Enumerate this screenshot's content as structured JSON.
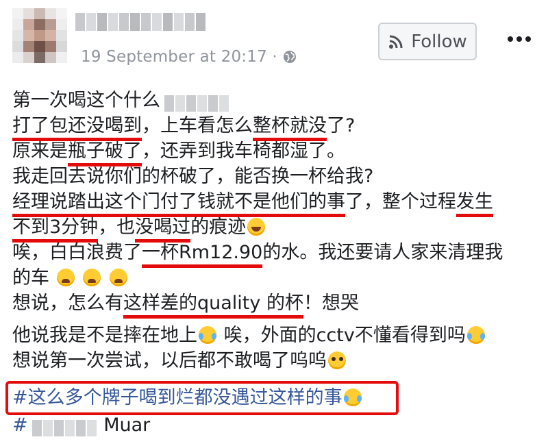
{
  "header": {
    "timestamp": "19 September at 20:17 ·",
    "follow_label": "Follow",
    "more_icon": "more-icon",
    "globe_icon": "globe-icon",
    "rss_icon": "rss-icon"
  },
  "post": {
    "l1": "第一次喝这个什么",
    "l2a": "打了包还没喝到",
    "l2b": "，上车看怎么",
    "l2c": "整杯就没",
    "l2d": "了?",
    "l3a": "原来是",
    "l3b": "瓶子破了",
    "l3c": "，还弄到我车椅都湿了。",
    "l4": "我走回去说你们的杯破了，能否换一杯给我?",
    "l5a": "经理说踏出这个门付了钱就不是他们的事",
    "l5b": "了，整个过程",
    "l5c": "发生",
    "l6a": "不到3分钟",
    "l6b": "，也",
    "l6c": "没喝过",
    "l6d": "的痕迹",
    "l7a": "唉，白白浪费了",
    "l7b": "一杯Rm12.90",
    "l7c": "的水。我还要请人家来清理我",
    "l8": "的车",
    "l9a": "想说，怎么有",
    "l9b": "这样差的quality 的杯",
    "l9c": "！想哭",
    "l10a": "他说我是不是摔在地上",
    "l10b": " 唉，外面的cctv不懂看得到吗",
    "l11": "想说第一次尝试，以后都不敢喝了呜呜",
    "hashtag1": "#这么多个牌子喝到烂都没遇过这样的事",
    "hashtag2_prefix": "#",
    "hashtag2_suffix": "Muar"
  },
  "colors": {
    "underline": "#e30b0b",
    "hashtag": "#365899",
    "timestamp": "#90949c"
  }
}
